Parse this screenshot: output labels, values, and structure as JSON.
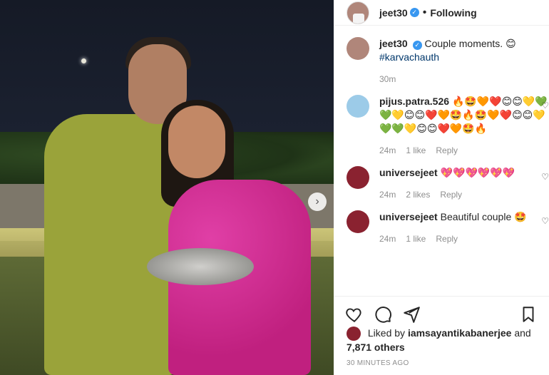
{
  "post": {
    "author": "jeet30",
    "follow_label": "Following",
    "separator": "•",
    "photo_alt": "Couple standing at night holding a puja thali"
  },
  "comments": [
    {
      "user": "jeet30",
      "text": "Couple moments. 😊",
      "hashtag": "#karvachauth",
      "time": "30m",
      "verified": true
    },
    {
      "user": "pijus.patra.526",
      "text": "🔥🤩🧡❤️😊😊💛💚💚💛😊😊❤️🧡🤩🔥🤩🧡❤️😊😊💛💚💚💛😊😊❤️🧡🤩🔥",
      "time": "24m",
      "likes": "1 like",
      "reply": "Reply"
    },
    {
      "user": "universejeet",
      "text": "💖💖💖💖💖💖",
      "time": "24m",
      "likes": "2 likes",
      "reply": "Reply"
    },
    {
      "user": "universejeet",
      "text": "Beautiful couple 🤩",
      "time": "24m",
      "likes": "1 like",
      "reply": "Reply"
    }
  ],
  "likes": {
    "prefix": "Liked by ",
    "user": "iamsayantikabanerjee",
    "connector": " and",
    "count": "7,871 others"
  },
  "time_ago": "30 MINUTES AGO",
  "icons": {
    "heart": "heart-icon",
    "comment": "comment-icon",
    "share": "share-icon",
    "save": "bookmark-icon",
    "next": "chevron-right-icon"
  },
  "colors": {
    "verified": "#3897f0",
    "hashtag": "#00376b",
    "muted": "#8e8e8e"
  }
}
